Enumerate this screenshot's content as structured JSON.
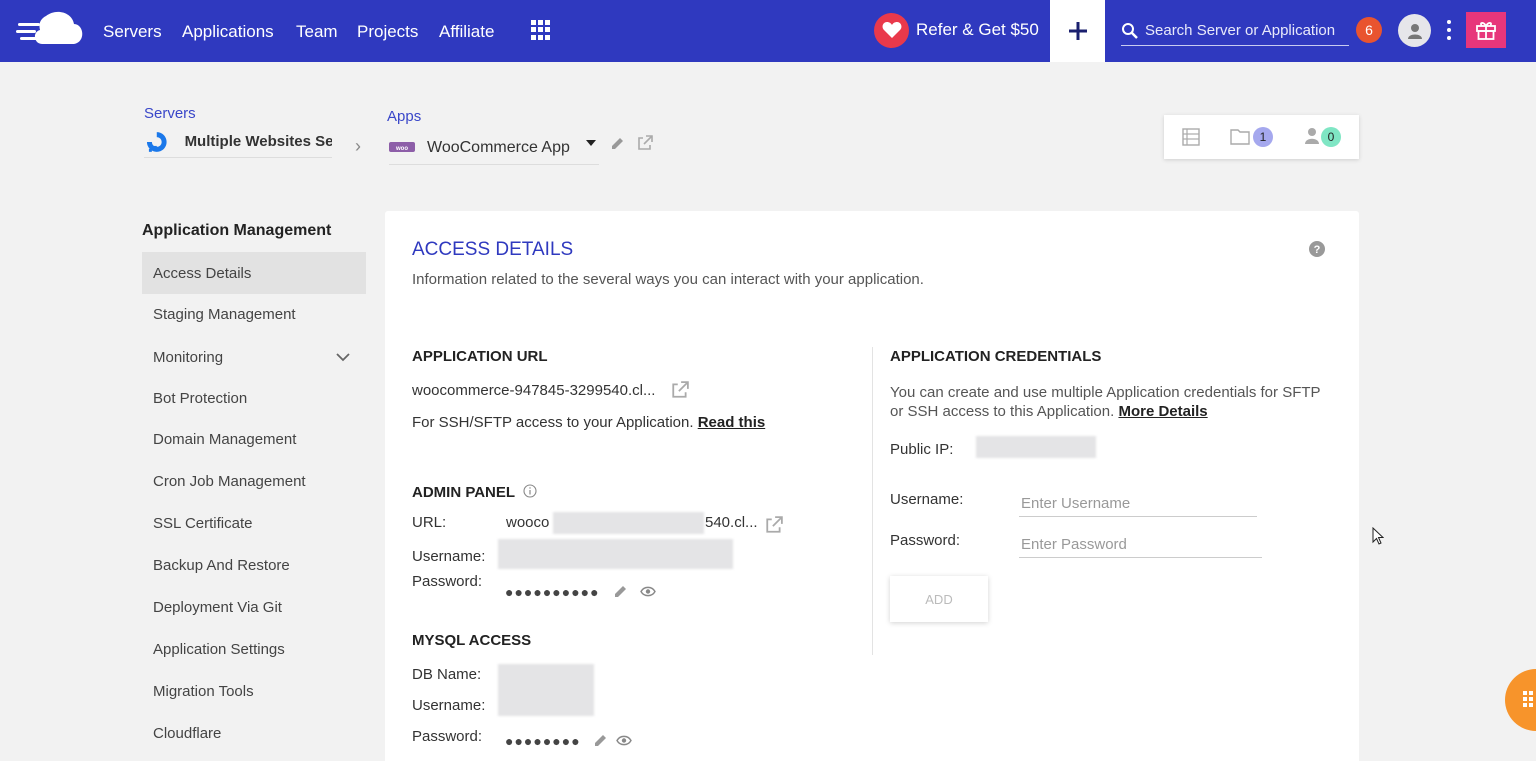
{
  "nav": {
    "items": [
      "Servers",
      "Applications",
      "Team",
      "Projects",
      "Affiliate"
    ],
    "refer_label": "Refer & Get $50",
    "search_placeholder": "Search Server or Application",
    "notification_count": "6"
  },
  "breadcrumb": {
    "servers_label": "Servers",
    "server_name": "Multiple Websites Ser",
    "apps_label": "Apps",
    "app_name": "WooCommerce App"
  },
  "counters": {
    "folders": "1",
    "members": "0"
  },
  "sidebar": {
    "title": "Application Management",
    "items": [
      {
        "label": "Access Details",
        "active": true
      },
      {
        "label": "Staging Management"
      },
      {
        "label": "Monitoring",
        "has_chevron": true
      },
      {
        "label": "Bot Protection"
      },
      {
        "label": "Domain Management"
      },
      {
        "label": "Cron Job Management"
      },
      {
        "label": "SSL Certificate"
      },
      {
        "label": "Backup And Restore"
      },
      {
        "label": "Deployment Via Git"
      },
      {
        "label": "Application Settings"
      },
      {
        "label": "Migration Tools"
      },
      {
        "label": "Cloudflare"
      }
    ]
  },
  "access": {
    "title": "ACCESS DETAILS",
    "subtitle": "Information related to the several ways you can interact with your application.",
    "app_url": {
      "heading": "APPLICATION URL",
      "url": "woocommerce-947845-3299540.cl...",
      "ssh_text": "For SSH/SFTP access to your Application.",
      "read_this": "Read this"
    },
    "admin": {
      "heading": "ADMIN PANEL",
      "url_label": "URL:",
      "url_start": "wooco",
      "url_end": "540.cl...",
      "username_label": "Username:",
      "password_label": "Password:",
      "password_mask": "●●●●●●●●●●"
    },
    "mysql": {
      "heading": "MYSQL ACCESS",
      "db_label": "DB Name:",
      "username_label": "Username:",
      "password_label": "Password:",
      "password_mask": "●●●●●●●●"
    },
    "credentials": {
      "heading": "APPLICATION CREDENTIALS",
      "desc": "You can create and use multiple Application credentials for SFTP or SSH access to this Application.",
      "more_details": "More Details",
      "public_ip_label": "Public IP:",
      "username_label": "Username:",
      "username_placeholder": "Enter Username",
      "password_label": "Password:",
      "password_placeholder": "Enter Password",
      "add_label": "ADD"
    }
  },
  "colors": {
    "brand": "#2f39bf",
    "accent_red": "#e9394b",
    "gift": "#e7367b",
    "fab": "#f7942b"
  }
}
